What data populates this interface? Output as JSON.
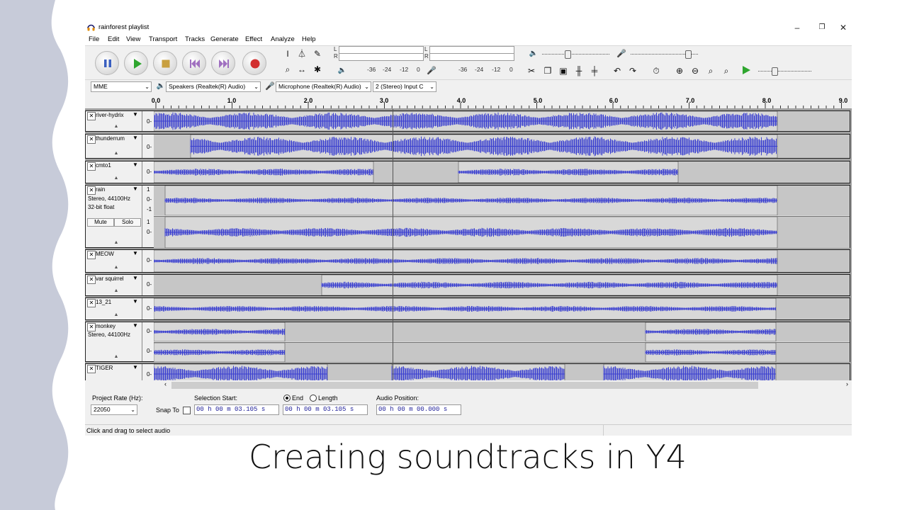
{
  "window": {
    "title": "rainforest playlist",
    "controls": [
      "–",
      "❐",
      "✕"
    ]
  },
  "menu": [
    "File",
    "Edit",
    "View",
    "Transport",
    "Tracks",
    "Generate",
    "Effect",
    "Analyze",
    "Help"
  ],
  "meters": {
    "record_ticks": [
      "-36",
      "-24",
      "-12",
      "0"
    ],
    "play_ticks": [
      "-36",
      "-24",
      "-12",
      "0"
    ],
    "record_channel_labels": [
      "L",
      "R"
    ],
    "play_channel_labels": [
      "L",
      "R"
    ],
    "playback_volume": 0.38,
    "record_volume": 0.85,
    "play_speed": 0.3
  },
  "devices": {
    "host": "MME",
    "output": "Speakers (Realtek(R) Audio)",
    "input": "Microphone (Realtek(R) Audio)",
    "channels": "2 (Stereo) Input C"
  },
  "ruler": {
    "ticks": [
      "0.0",
      "1.0",
      "2.0",
      "3.0",
      "4.0",
      "5.0",
      "6.0",
      "7.0",
      "8.0",
      "9.0"
    ]
  },
  "tracks": [
    {
      "name": "river-hydrix",
      "scale": [
        "0-"
      ]
    },
    {
      "name": "thunderrum",
      "scale": [
        "0-"
      ]
    },
    {
      "name": "cmto1",
      "scale": [
        "0-"
      ]
    },
    {
      "name": "rain",
      "info": [
        "Stereo, 44100Hz",
        "32-bit float"
      ],
      "mute": "Mute",
      "solo": "Solo",
      "scale_top": [
        "1",
        "0-",
        "-1"
      ],
      "scale_bottom": [
        "1",
        "0-"
      ]
    },
    {
      "name": "MEOW",
      "scale": [
        "0-"
      ]
    },
    {
      "name": "var squirrel",
      "scale": [
        "0-"
      ]
    },
    {
      "name": "13_21",
      "scale": [
        "0-"
      ]
    },
    {
      "name": "monkey",
      "info": [
        "Stereo, 44100Hz"
      ],
      "scale": [
        "0-",
        "0-"
      ]
    },
    {
      "name": "TIGER",
      "scale": [
        "0-"
      ]
    }
  ],
  "selection_toolbar": {
    "project_rate_label": "Project Rate (Hz):",
    "project_rate": "22050",
    "snap_to": "Snap To",
    "selection_start_label": "Selection Start:",
    "end_label": "End",
    "length_label": "Length",
    "audio_position_label": "Audio Position:",
    "start_value": "00 h 00 m 03.105 s",
    "end_value": "00 h 00 m 03.105 s",
    "position_value": "00 h 00 m 00.000 s"
  },
  "status": "Click and drag to select audio",
  "caption": "Creating soundtracks in Y4",
  "colors": {
    "wave": "#3a3fd0",
    "clip_bg": "#d8d8d8",
    "gap_bg": "#c6c6c6"
  }
}
